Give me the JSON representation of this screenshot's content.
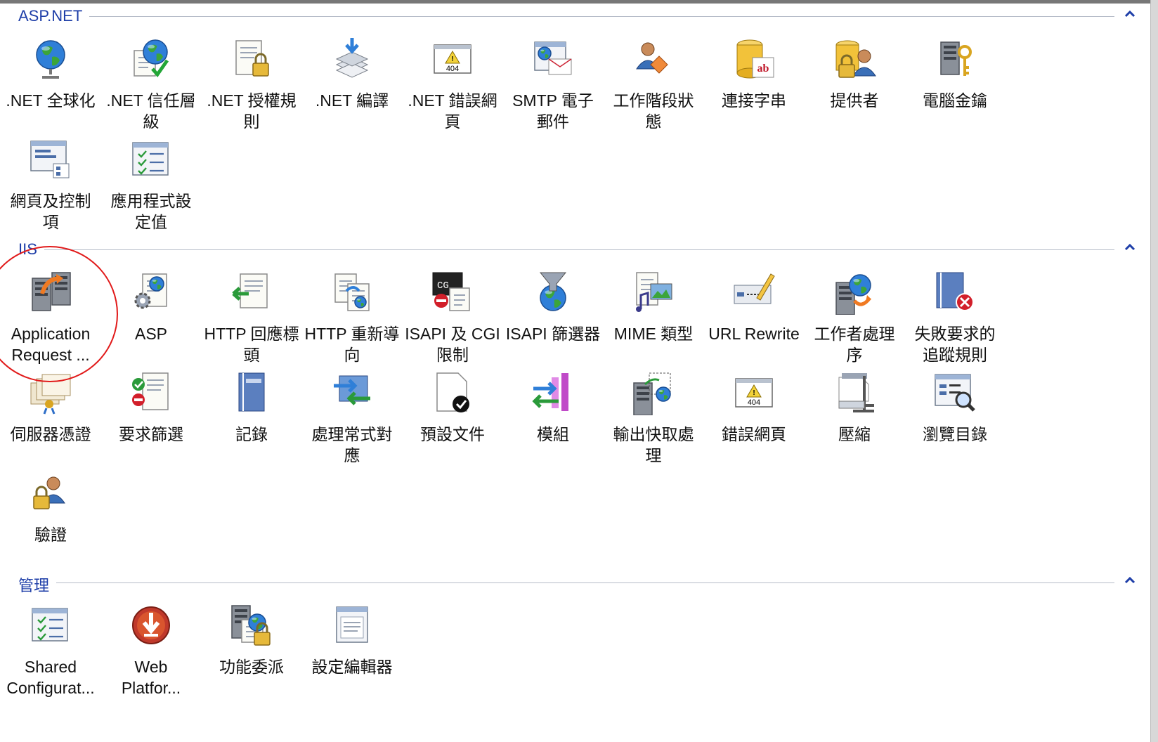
{
  "groups": [
    {
      "title": "ASP.NET",
      "items": [
        {
          "label": ".NET 全球化",
          "icon": "globe-stand-icon"
        },
        {
          "label": ".NET 信任層\n級",
          "icon": "trust-globe-check-icon"
        },
        {
          "label": ".NET 授權規\n則",
          "icon": "auth-rules-lock-icon"
        },
        {
          "label": ".NET 編譯",
          "icon": "compile-stack-icon"
        },
        {
          "label": ".NET 錯誤網\n頁",
          "icon": "error-404-icon"
        },
        {
          "label": "SMTP 電子\n郵件",
          "icon": "smtp-email-icon"
        },
        {
          "label": "工作階段狀\n態",
          "icon": "session-state-icon"
        },
        {
          "label": "連接字串",
          "icon": "connection-string-icon"
        },
        {
          "label": "提供者",
          "icon": "providers-icon"
        },
        {
          "label": "電腦金鑰",
          "icon": "machine-key-icon"
        },
        {
          "label": "網頁及控制\n項",
          "icon": "pages-controls-icon"
        },
        {
          "label": "應用程式設\n定值",
          "icon": "app-settings-icon"
        }
      ]
    },
    {
      "title": "IIS",
      "items": [
        {
          "label": "Application\nRequest ...",
          "icon": "arr-server-icon"
        },
        {
          "label": "ASP",
          "icon": "asp-gear-icon"
        },
        {
          "label": "HTTP 回應標\n頭",
          "icon": "http-response-headers-icon"
        },
        {
          "label": "HTTP 重新導\n向",
          "icon": "http-redirect-icon"
        },
        {
          "label": "ISAPI 及 CGI\n限制",
          "icon": "isapi-cgi-icon"
        },
        {
          "label": "ISAPI 篩選器",
          "icon": "isapi-filter-icon"
        },
        {
          "label": "MIME 類型",
          "icon": "mime-types-icon"
        },
        {
          "label": "URL Rewrite",
          "icon": "url-rewrite-icon"
        },
        {
          "label": "工作者處理\n序",
          "icon": "worker-process-icon"
        },
        {
          "label": "失敗要求的\n追蹤規則",
          "icon": "failed-request-tracing-icon"
        },
        {
          "label": "伺服器憑證",
          "icon": "server-certificates-icon"
        },
        {
          "label": "要求篩選",
          "icon": "request-filtering-icon"
        },
        {
          "label": "記錄",
          "icon": "logging-icon"
        },
        {
          "label": "處理常式對\n應",
          "icon": "handler-mappings-icon"
        },
        {
          "label": "預設文件",
          "icon": "default-document-icon"
        },
        {
          "label": "模組",
          "icon": "modules-icon"
        },
        {
          "label": "輸出快取處\n理",
          "icon": "output-caching-icon"
        },
        {
          "label": "錯誤網頁",
          "icon": "error-pages-icon"
        },
        {
          "label": "壓縮",
          "icon": "compression-icon"
        },
        {
          "label": "瀏覽目錄",
          "icon": "directory-browsing-icon"
        },
        {
          "label": "驗證",
          "icon": "authentication-icon"
        }
      ]
    },
    {
      "title": "管理",
      "items": [
        {
          "label": "Shared\nConfigurat...",
          "icon": "shared-configuration-icon"
        },
        {
          "label": "Web\nPlatfor...",
          "icon": "web-platform-installer-icon"
        },
        {
          "label": "功能委派",
          "icon": "feature-delegation-icon"
        },
        {
          "label": "設定編輯器",
          "icon": "configuration-editor-icon"
        }
      ]
    }
  ],
  "annotation": {
    "highlighted_item": "Application\nRequest ...",
    "color": "#e11a1a"
  },
  "colors": {
    "group_title": "#1e3ea8",
    "group_line": "#b6bcc8",
    "label_text": "#111111"
  }
}
